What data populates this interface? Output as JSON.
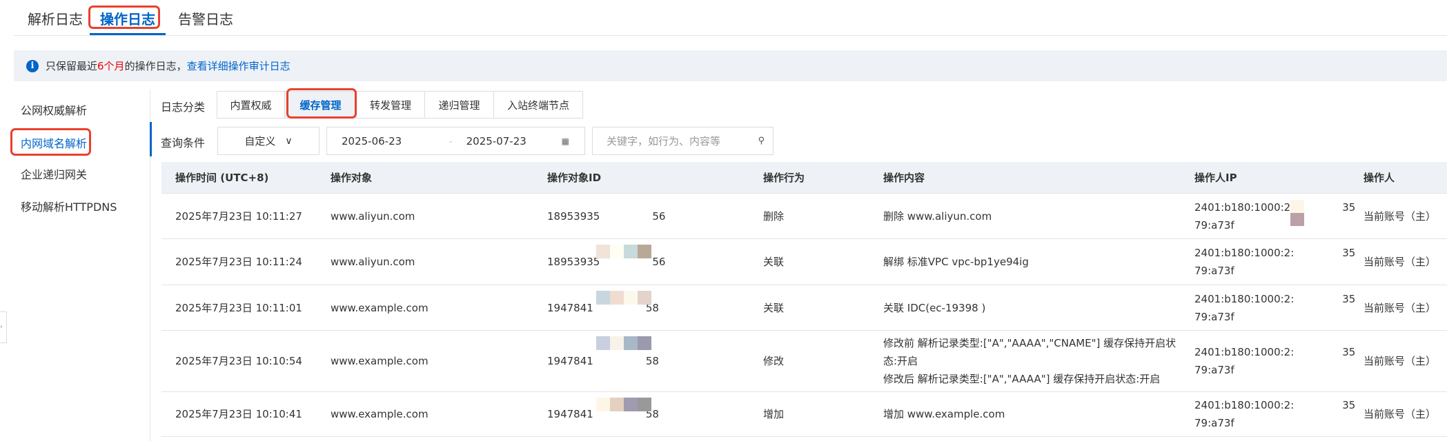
{
  "top_tabs": [
    {
      "label": "解析日志"
    },
    {
      "label": "操作日志"
    },
    {
      "label": "告警日志"
    }
  ],
  "info": {
    "prefix": "只保留最近",
    "highlight": "6个月",
    "suffix": "的操作日志，",
    "link": "查看详细操作审计日志"
  },
  "sidebar": {
    "items": [
      {
        "label": "公网权威解析"
      },
      {
        "label": "内网域名解析"
      },
      {
        "label": "企业递归网关"
      },
      {
        "label": "移动解析HTTPDNS"
      }
    ]
  },
  "filters": {
    "category_label": "日志分类",
    "categories": [
      {
        "label": "内置权威"
      },
      {
        "label": "缓存管理"
      },
      {
        "label": "转发管理"
      },
      {
        "label": "递归管理"
      },
      {
        "label": "入站终端节点"
      }
    ],
    "query_label": "查询条件",
    "range_select": "自定义",
    "date_start": "2025-06-23",
    "date_sep": "-",
    "date_end": "2025-07-23",
    "search_placeholder": "关键字，如行为、内容等"
  },
  "table": {
    "columns": [
      "操作时间 (UTC+8)",
      "操作对象",
      "操作对象ID",
      "操作行为",
      "操作内容",
      "操作人IP",
      "操作人"
    ],
    "rows": [
      {
        "time": "2025年7月23日 10:11:27",
        "object": "www.aliyun.com",
        "id_a": "18953935",
        "id_b": "56",
        "action": "删除",
        "content": [
          "删除 www.aliyun.com"
        ],
        "ip1": "2401:b180:1000:2:",
        "ip1b": "35",
        "ip2": "79:a73f",
        "operator": "当前账号（主）"
      },
      {
        "time": "2025年7月23日 10:11:24",
        "object": "www.aliyun.com",
        "id_a": "18953935",
        "id_b": "56",
        "action": "关联",
        "content": [
          "解绑 标准VPC vpc-bp1ye94ig"
        ],
        "ip1": "2401:b180:1000:2:",
        "ip1b": "35",
        "ip2": "79:a73f",
        "operator": "当前账号（主）"
      },
      {
        "time": "2025年7月23日 10:11:01",
        "object": "www.example.com",
        "id_a": "1947841",
        "id_b": "58",
        "action": "关联",
        "content": [
          "关联 IDC(ec-19398 )"
        ],
        "ip1": "2401:b180:1000:2:",
        "ip1b": "35",
        "ip2": "79:a73f",
        "operator": "当前账号（主）"
      },
      {
        "time": "2025年7月23日 10:10:54",
        "object": "www.example.com",
        "id_a": "1947841",
        "id_b": "58",
        "action": "修改",
        "content": [
          "修改前  解析记录类型:[\"A\",\"AAAA\",\"CNAME\"] 缓存保持开启状",
          "态:开启",
          "修改后  解析记录类型:[\"A\",\"AAAA\"] 缓存保持开启状态:开启"
        ],
        "ip1": "2401:b180:1000:2:",
        "ip1b": "35",
        "ip2": "79:a73f",
        "operator": "当前账号（主）"
      },
      {
        "time": "2025年7月23日 10:10:41",
        "object": "www.example.com",
        "id_a": "1947841",
        "id_b": "58",
        "action": "增加",
        "content": [
          "增加 www.example.com"
        ],
        "ip1": "2401:b180:1000:2:",
        "ip1b": "35",
        "ip2": "79:a73f",
        "operator": "当前账号（主）"
      }
    ]
  },
  "colors": {
    "accent": "#0064c8",
    "highlight_box": "#e8412c",
    "header_bg": "#eef2f7"
  }
}
